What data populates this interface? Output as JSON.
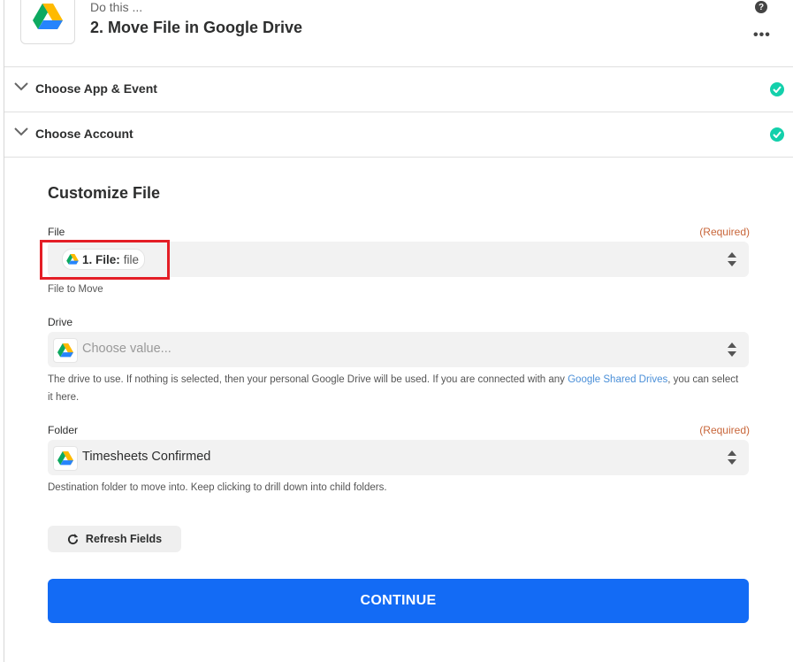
{
  "header": {
    "kicker": "Do this ...",
    "title": "2. Move File in Google Drive",
    "help_symbol": "?",
    "more_symbol": "•••",
    "app_icon": "google-drive-icon"
  },
  "sections": [
    {
      "label": "Choose App & Event",
      "status": "complete",
      "icon": "chevron-down-icon"
    },
    {
      "label": "Choose Account",
      "status": "complete",
      "icon": "chevron-down-icon"
    }
  ],
  "customize": {
    "title": "Customize File",
    "file": {
      "label": "File",
      "required_text": "(Required)",
      "pill_step": "1. File:",
      "pill_value": "file",
      "helper": "File to Move"
    },
    "drive": {
      "label": "Drive",
      "placeholder": "Choose value...",
      "helper_prefix": "The drive to use. If nothing is selected, then your personal Google Drive will be used. If you are connected with any ",
      "helper_link": "Google Shared Drives",
      "helper_suffix": ", you can select it here."
    },
    "folder": {
      "label": "Folder",
      "required_text": "(Required)",
      "value": "Timesheets Confirmed",
      "helper": "Destination folder to move into. Keep clicking to drill down into child folders."
    },
    "refresh_label": "Refresh Fields",
    "continue_label": "CONTINUE"
  },
  "colors": {
    "accent_blue": "#136bf5",
    "check_green": "#13d0ab",
    "required_orange": "#c8663a",
    "highlight_red": "#e41e26",
    "link_blue": "#4a8fd8"
  }
}
